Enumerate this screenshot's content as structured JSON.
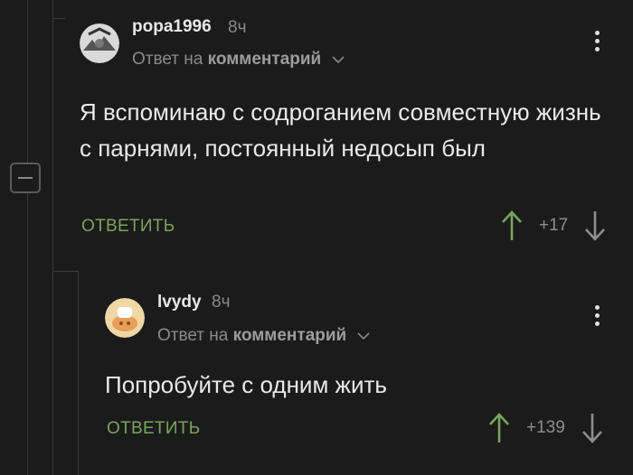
{
  "comments": [
    {
      "username": "popa1996",
      "time": "8ч",
      "reply_prefix": "Ответ на",
      "reply_target": "комментарий",
      "text": "Я вспоминаю с содроганием совместную жизнь с парнями, постоянный недосып был",
      "reply_label": "ОТВЕТИТЬ",
      "score": "+17"
    },
    {
      "username": "lvydy",
      "time": "8ч",
      "reply_prefix": "Ответ на",
      "reply_target": "комментарий",
      "text": "Попробуйте с одним жить",
      "reply_label": "ОТВЕТИТЬ",
      "score": "+139"
    }
  ],
  "colors": {
    "background": "#1b1b1c",
    "accent_green": "#78a65a",
    "muted": "#8a8a8a"
  },
  "icons": [
    "collapse-icon",
    "kebab-menu-icon",
    "chevron-down-icon",
    "upvote-arrow-icon",
    "downvote-arrow-icon"
  ]
}
